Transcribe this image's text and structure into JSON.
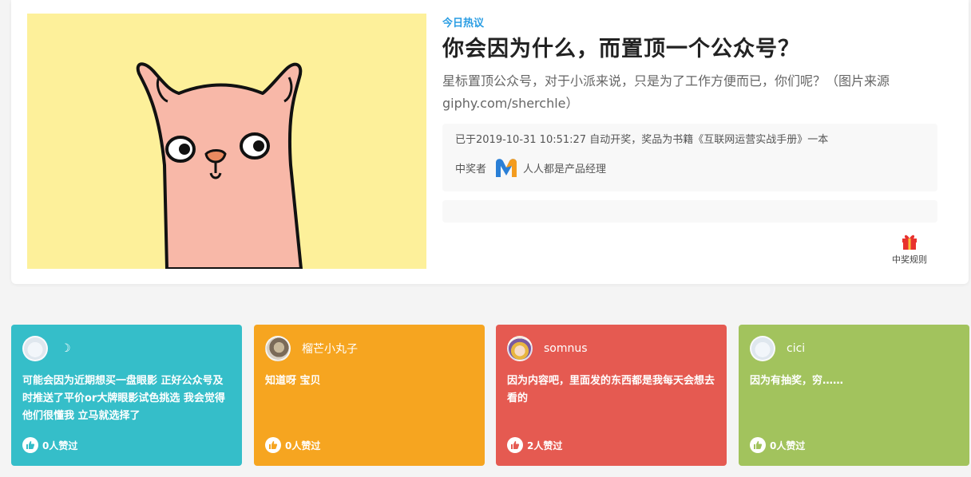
{
  "topic": {
    "tag": "今日热议",
    "title": "你会因为什么，而置顶一个公众号？",
    "description": "星标置顶公众号，对于小派来说，只是为了工作方便而已，你们呢？（图片来源 giphy.com/sherchle）",
    "award_text": "已于2019-10-31 10:51:27 自动开奖，奖品为书籍《互联网运营实战手册》一本",
    "winner_label": "中奖者",
    "winner_name": "人人都是产品经理",
    "rules_label": "中奖规则"
  },
  "colors": {
    "accent": "#2a9de3",
    "card_teal": "#35bec9",
    "card_orange": "#f6a520",
    "card_red": "#e55a51",
    "card_green": "#a2c35d"
  },
  "comments": [
    {
      "user": "",
      "user_icon": "moon-icon",
      "moon": "☽",
      "text": "可能会因为近期想买一盘眼影 正好公众号及时推送了平价or大牌眼影试色挑选 我会觉得他们很懂我 立马就选择了",
      "likes": "0人赞过"
    },
    {
      "user": "榴芒小丸子",
      "text": "知道呀 宝贝",
      "likes": "0人赞过"
    },
    {
      "user": "somnus",
      "text": "因为内容吧，里面发的东西都是我每天会想去看的",
      "likes": "2人赞过"
    },
    {
      "user": "cici",
      "text": "因为有抽奖，穷……",
      "likes": "0人赞过"
    }
  ]
}
